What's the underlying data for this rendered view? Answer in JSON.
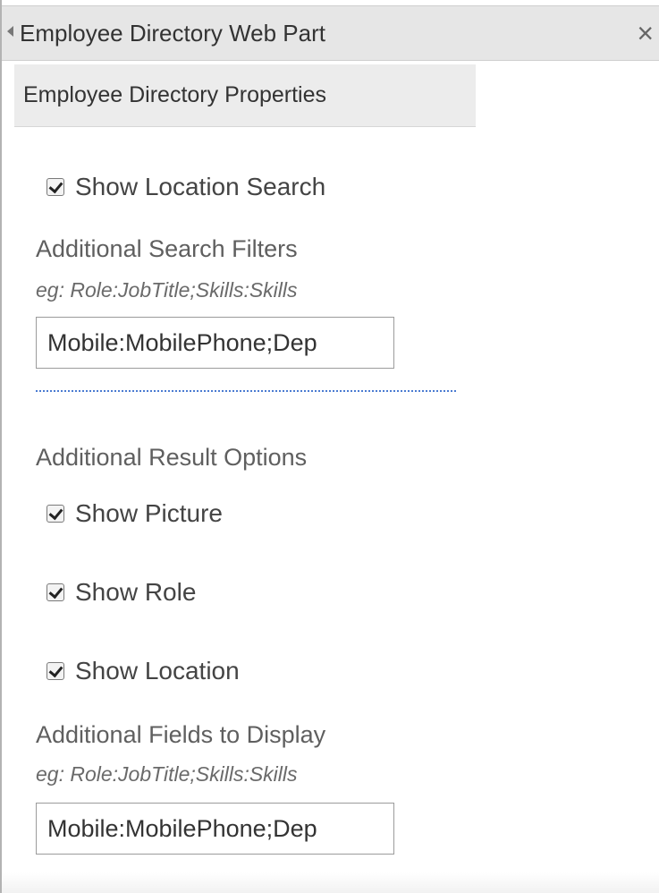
{
  "header": {
    "title": "Employee Directory Web Part",
    "close_glyph": "×"
  },
  "section": {
    "title": "Employee Directory Properties"
  },
  "location_search": {
    "label": "Show Location Search",
    "checked": true
  },
  "search_filters": {
    "label": "Additional Search Filters",
    "hint": "eg: Role:JobTitle;Skills:Skills",
    "value": "Mobile:MobilePhone;Dep"
  },
  "result_options": {
    "label": "Additional Result Options",
    "items": [
      {
        "label": "Show Picture",
        "checked": true
      },
      {
        "label": "Show Role",
        "checked": true
      },
      {
        "label": "Show Location",
        "checked": true
      }
    ]
  },
  "fields_display": {
    "label": "Additional Fields to Display",
    "hint": "eg: Role:JobTitle;Skills:Skills",
    "value": "Mobile:MobilePhone;Dep"
  }
}
